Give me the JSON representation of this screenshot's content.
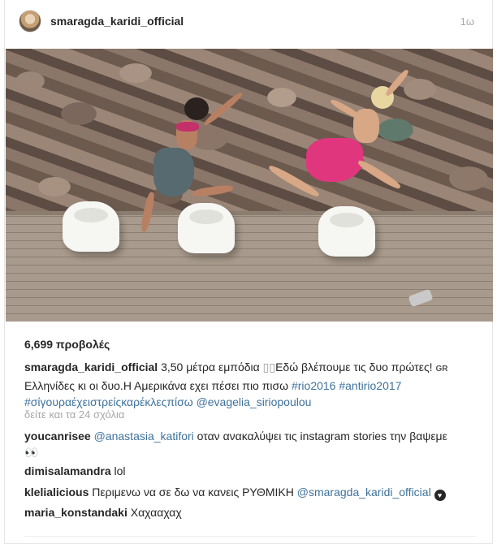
{
  "post": {
    "username": "smaragda_karidi_official",
    "timestamp": "1ω",
    "views": "6,699 προβολές",
    "caption": {
      "username": "smaragda_karidi_official",
      "text_1": "3,50 μέτρα εμπόδια ",
      "emoji_placeholder": "▯▯",
      "text_2": "Εδώ βλέπουμε τις δυο πρώτες! ",
      "flag": "GR",
      "text_3": " Ελληνίδες κι οι δυο.Η Αμερικάνα εχει πέσει πιο πισω ",
      "hashtag_1": "#rio2016",
      "hashtag_2": "#antirio2017",
      "hashtag_3": "#σίγουραέχειστρείςκαρέκλεςπίσω",
      "mention": "@evagelia_siriopoulou"
    },
    "view_comments": "δείτε και τα 24 σχόλια"
  },
  "comments": [
    {
      "username": "youcanrisee",
      "mention": "@anastasia_katifori",
      "text": " οταν ανακαλύψει τις instagram stories την βαψεμε",
      "emoji": "👀"
    },
    {
      "username": "dimisalamandra",
      "text": "lol"
    },
    {
      "username": "klelialicious",
      "text": "Περιμενω να σε δω να κανεις ΡΥΘΜΙΚΗ ",
      "mention": "@smaragda_karidi_official",
      "emoji": "♥"
    },
    {
      "username": "maria_konstandaki",
      "text": "Χαχααχαχ"
    }
  ],
  "icons": {
    "avatar": "profile-avatar",
    "heart": "heart-icon"
  },
  "colors": {
    "link": "#3f729b",
    "muted": "#a5a7aa",
    "text": "#262626"
  }
}
